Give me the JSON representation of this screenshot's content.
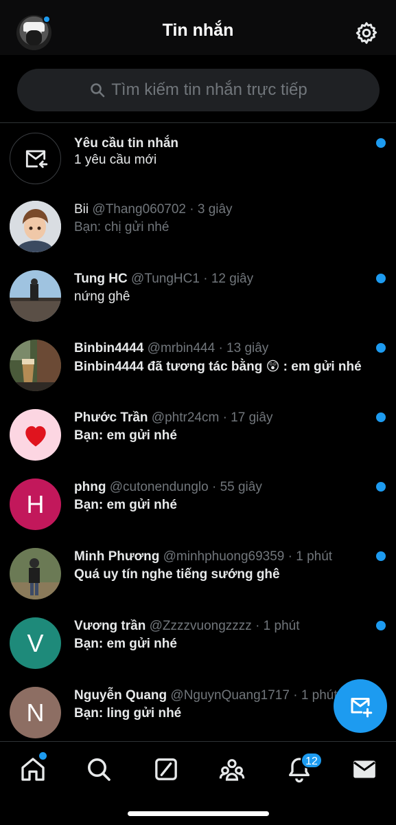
{
  "header": {
    "title": "Tin nhắn",
    "has_notification_dot": true
  },
  "search": {
    "placeholder": "Tìm kiếm tin nhắn trực tiếp"
  },
  "request": {
    "title": "Yêu cầu tin nhắn",
    "subtitle": "1 yêu cầu mới",
    "unread": true
  },
  "conversations": [
    {
      "name": "Bii",
      "handle": "@Thang060702",
      "time": "· 3 giây",
      "message": "Bạn: chị gửi nhé",
      "unread": false,
      "bold": false,
      "avatar": "cartoon-boy"
    },
    {
      "name": "Tung HC",
      "handle": "@TungHC1",
      "time": "· 12 giây",
      "message": "nứng ghê",
      "unread": true,
      "bold": true,
      "avatar": "photo-wall"
    },
    {
      "name": "Binbin4444",
      "handle": "@mrbin444",
      "time": "· 13 giây",
      "message": "Binbin4444 đã tương tác bằng 😲 : em gửi nhé",
      "unread": true,
      "bold": true,
      "avatar": "photo-cafe"
    },
    {
      "name": "Phước Trần",
      "handle": "@phtr24cm",
      "time": "· 17 giây",
      "message": "Bạn: em gửi nhé",
      "unread": true,
      "bold": true,
      "avatar": "heart"
    },
    {
      "name": "phng",
      "handle": "@cutonendunglo",
      "time": "· 55 giây",
      "message": "Bạn: em gửi nhé",
      "unread": true,
      "bold": true,
      "avatar": "letter",
      "letter": "H",
      "color": "#c2185b"
    },
    {
      "name": "Minh Phương",
      "handle": "@minhphuong69359",
      "time": "· 1 phút",
      "message": "Quá uy tín nghe tiếng sướng ghê",
      "unread": true,
      "bold": true,
      "avatar": "photo-man"
    },
    {
      "name": "Vương trần",
      "handle": "@Zzzzvuongzzzz",
      "time": "· 1 phút",
      "message": "Bạn: em gửi nhé",
      "unread": true,
      "bold": true,
      "avatar": "letter",
      "letter": "V",
      "color": "#1e8a7a"
    },
    {
      "name": "Nguyễn Quang",
      "handle": "@NguynQuang1717",
      "time": "· 1 phút",
      "message": "Bạn: ling gửi nhé",
      "unread": false,
      "bold": true,
      "avatar": "letter",
      "letter": "N",
      "color": "#8d6e63"
    }
  ],
  "tabbar": {
    "items": [
      "home-icon",
      "search-icon",
      "grok-icon",
      "communities-icon",
      "notifications-icon",
      "messages-icon"
    ],
    "notifications_badge": "12",
    "home_dot": true
  },
  "colors": {
    "accent": "#1d9bf0",
    "background": "#000000",
    "muted": "#71767b"
  }
}
